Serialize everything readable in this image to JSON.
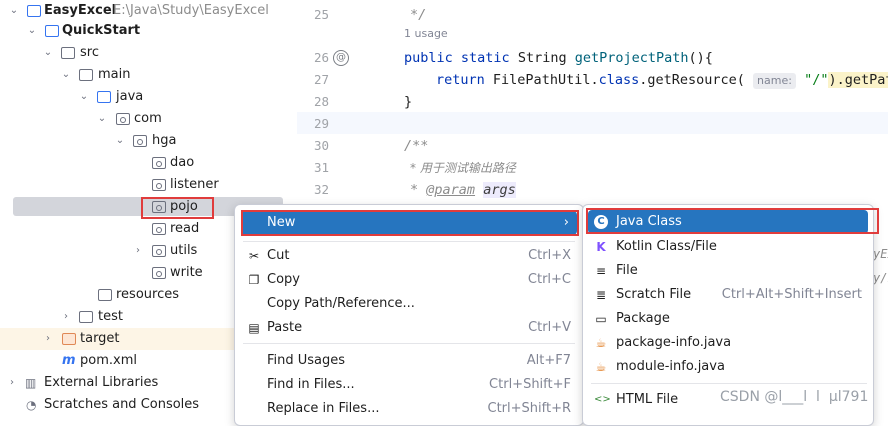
{
  "tree": {
    "project": {
      "name": "EasyExcel",
      "path": "E:\\Java\\Study\\EasyExcel"
    },
    "items": [
      {
        "label": "QuickStart"
      },
      {
        "label": "src"
      },
      {
        "label": "main"
      },
      {
        "label": "java"
      },
      {
        "label": "com"
      },
      {
        "label": "hga"
      },
      {
        "label": "dao"
      },
      {
        "label": "listener"
      },
      {
        "label": "pojo"
      },
      {
        "label": "read"
      },
      {
        "label": "utils"
      },
      {
        "label": "write"
      },
      {
        "label": "resources"
      },
      {
        "label": "test"
      },
      {
        "label": "target"
      },
      {
        "label": "pom.xml"
      },
      {
        "label": "External Libraries"
      },
      {
        "label": "Scratches and Consoles"
      }
    ]
  },
  "editor": {
    "lines": [
      "25",
      "26",
      "27",
      "28",
      "29",
      "30",
      "31",
      "32"
    ],
    "usage": "1 usage",
    "code": {
      "l25": "*/",
      "l26_kw": "public static",
      "l26_type": "String",
      "l26_fn": "getProjectPath",
      "l26_end": "(){",
      "l27_kw": "return",
      "l27_mid": "FilePathUtil.",
      "l27_cls": "class",
      "l27_call": ".getResource(",
      "l27_hint": "name:",
      "l27_str": "\"/\"",
      "l27_tail": ").getPath(",
      "l28": "}",
      "l30": "/**",
      "l31": "* 用于测试输出路径",
      "l32_tag": "@param",
      "l32_arg": "args"
    },
    "right_overflow": [
      "yEx",
      "y/E"
    ]
  },
  "context_menu": {
    "items": [
      {
        "label": "New",
        "shortcut": ""
      },
      {
        "label": "Cut",
        "shortcut": "Ctrl+X"
      },
      {
        "label": "Copy",
        "shortcut": "Ctrl+C"
      },
      {
        "label": "Copy Path/Reference...",
        "shortcut": ""
      },
      {
        "label": "Paste",
        "shortcut": "Ctrl+V"
      },
      {
        "label": "Find Usages",
        "shortcut": "Alt+F7"
      },
      {
        "label": "Find in Files...",
        "shortcut": "Ctrl+Shift+F"
      },
      {
        "label": "Replace in Files...",
        "shortcut": "Ctrl+Shift+R"
      }
    ]
  },
  "submenu": {
    "items": [
      {
        "label": "Java Class",
        "shortcut": ""
      },
      {
        "label": "Kotlin Class/File",
        "shortcut": ""
      },
      {
        "label": "File",
        "shortcut": ""
      },
      {
        "label": "Scratch File",
        "shortcut": "Ctrl+Alt+Shift+Insert"
      },
      {
        "label": "Package",
        "shortcut": ""
      },
      {
        "label": "package-info.java",
        "shortcut": ""
      },
      {
        "label": "module-info.java",
        "shortcut": ""
      },
      {
        "label": "HTML File",
        "shortcut": ""
      }
    ]
  },
  "watermark": "CSDN @l___l  l  µl791",
  "colors": {
    "selection": "#2675bf",
    "highlight_box": "#e03c3c",
    "keyword": "#0033b3"
  }
}
